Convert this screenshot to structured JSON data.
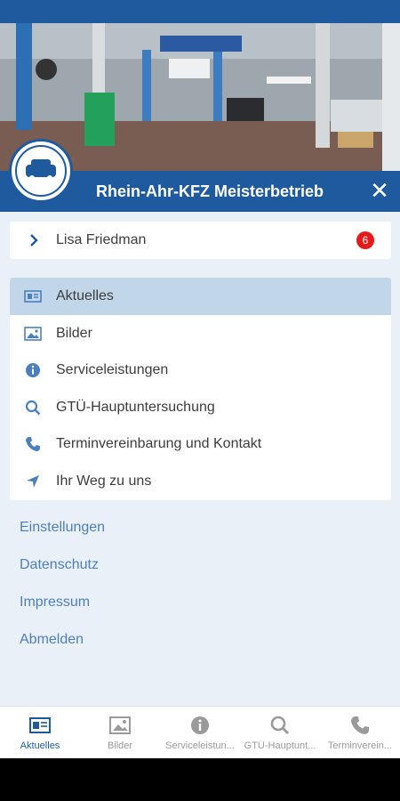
{
  "header": {
    "title": "Rhein-Ahr-KFZ Meisterbetrieb",
    "close_icon": "close-icon",
    "brand_color": "#1f5a9e"
  },
  "user": {
    "name": "Lisa Friedman",
    "badge_count": "6"
  },
  "menu": {
    "items": [
      {
        "label": "Aktuelles",
        "icon": "news-icon",
        "active": true
      },
      {
        "label": "Bilder",
        "icon": "image-icon"
      },
      {
        "label": "Serviceleistungen",
        "icon": "info-icon"
      },
      {
        "label": "GTÜ-Hauptuntersuchung",
        "icon": "search-icon"
      },
      {
        "label": "Terminvereinbarung und Kontakt",
        "icon": "phone-icon"
      },
      {
        "label": "Ihr Weg zu uns",
        "icon": "navigation-arrow-icon"
      }
    ]
  },
  "links": [
    "Einstellungen",
    "Datenschutz",
    "Impressum",
    "Abmelden"
  ],
  "bottom_nav": {
    "tabs": [
      {
        "label": "Aktuelles",
        "icon": "news-icon",
        "active": true
      },
      {
        "label": "Bilder",
        "icon": "image-icon"
      },
      {
        "label": "Serviceleistun...",
        "icon": "info-icon"
      },
      {
        "label": "GTÜ-Hauptunt...",
        "icon": "search-icon"
      },
      {
        "label": "Terminverein...",
        "icon": "phone-icon"
      }
    ]
  }
}
